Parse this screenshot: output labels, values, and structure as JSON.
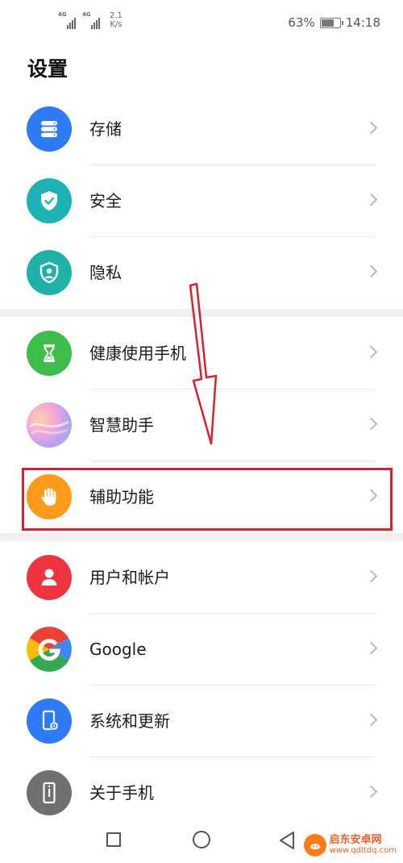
{
  "status_bar": {
    "signal1_label": "4G",
    "signal2_label": "4G",
    "speed_value": "2.1",
    "speed_unit": "K/s",
    "battery": "63%",
    "battery_level": 0.63,
    "time": "14:18"
  },
  "page_title": "设置",
  "settings": {
    "items": [
      {
        "label": "存储",
        "icon": "storage-icon",
        "color": "#2f7bf5"
      },
      {
        "label": "安全",
        "icon": "shield-check-icon",
        "color": "#1fb2b5"
      },
      {
        "label": "隐私",
        "icon": "privacy-icon",
        "color": "#20b2a8"
      },
      {
        "label": "健康使用手机",
        "icon": "hourglass-icon",
        "color": "#3fbd4b"
      },
      {
        "label": "智慧助手",
        "icon": "smart-assistant-icon",
        "color": "#b9a0f0"
      },
      {
        "label": "辅助功能",
        "icon": "hand-icon",
        "color": "#ff9a1a"
      },
      {
        "label": "用户和帐户",
        "icon": "user-icon",
        "color": "#ef3340"
      },
      {
        "label": "Google",
        "icon": "google-icon",
        "color": "#4285f4"
      },
      {
        "label": "系统和更新",
        "icon": "system-update-icon",
        "color": "#2f7bf5"
      },
      {
        "label": "关于手机",
        "icon": "phone-info-icon",
        "color": "#707070"
      }
    ]
  },
  "highlight_color": "#d4232f",
  "watermark": {
    "title": "启东安卓网",
    "url": "www.qdltdq.com"
  }
}
